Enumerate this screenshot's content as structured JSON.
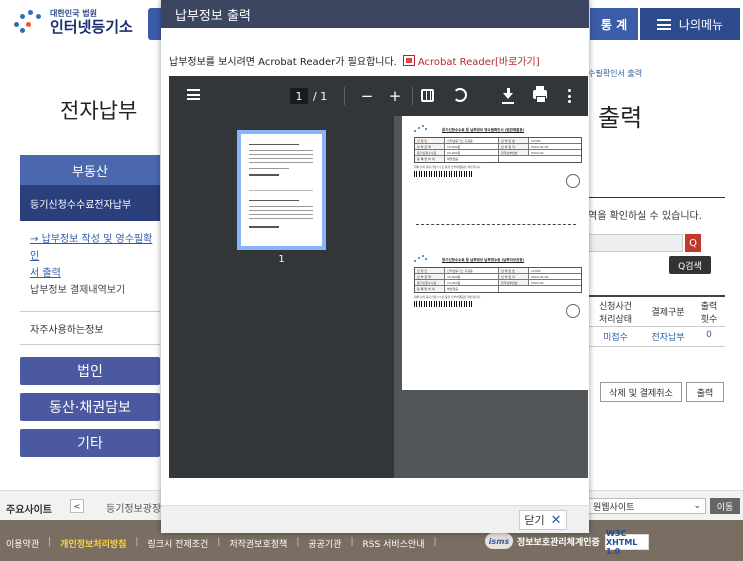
{
  "background": {
    "logo": {
      "top": "대한민국 법원",
      "main": "인터넷등기소"
    },
    "nav": {
      "stat": "통 계",
      "menu": "나의메뉴"
    },
    "breadcrumb": "수필확인서 출력",
    "title_left": "전자납부",
    "title_right": "출력",
    "sidebar": {
      "header": "부동산",
      "sub": "등기신청수수료전자납부",
      "links": [
        {
          "label": "납부정보 작성 및 영수필확인",
          "style": "link"
        },
        {
          "label": "서 출력",
          "style": "link"
        },
        {
          "label": "납부정보 결제내역보기",
          "style": "plain"
        }
      ],
      "frequent": "자주사용하는정보",
      "buttons": [
        "법인",
        "동산·채권담보",
        "기타"
      ]
    },
    "right_panel": {
      "note": "역을 확인하실 수 있습니다.",
      "search_btn": "Q",
      "find_btn": "Q검색",
      "table": {
        "headers": [
          "신청사건\n처리상태",
          "결제구분",
          "출력\n횟수"
        ],
        "row": [
          "미접수",
          "전자납부",
          "0"
        ]
      },
      "cancel_btn": "삭제 및 결제취소",
      "print_btn": "출력"
    },
    "sites": {
      "label": "주요사이트",
      "prev": "<",
      "item": "등기정보광장",
      "select": "원웹사이트",
      "go": "이동"
    },
    "footer": {
      "links": [
        "이용약관",
        "개인정보처리방침",
        "링크시 전제조건",
        "저작권보호정책",
        "공공기관",
        "RSS 서비스안내"
      ],
      "isms": "정보보호관리체계인증",
      "isms_mark": "isms",
      "w3c": "W3C XHTML 1.0"
    }
  },
  "modal": {
    "title": "납부정보 출력",
    "notice": "납부정보를 보시려면 Acrobat Reader가 필요합니다.",
    "acrobat_link": "Acrobat Reader[바로가기]",
    "viewer": {
      "page_current": "1",
      "page_total": "/ 1",
      "zoom_out": "−",
      "zoom_in": "+",
      "thumb_number": "1"
    },
    "close": "닫기"
  },
  "document": {
    "title_top": "등기신청수수료 등 납부정보 영수필확인서 (법원제출용)",
    "title_bottom": "등기신청수수료 등 납부정보 납부영수증 (납부자보관용)",
    "rows": [
      [
        "신 청 인",
        "인터넷등기소 홍길동",
        "납 부 번 호",
        "12345"
      ],
      [
        "납 부 금 액",
        "15,000원",
        "납 부 일 자",
        "2024-01-02"
      ],
      [
        "등기신청수수료",
        "15,000원",
        "전자납부번호",
        "0000-00"
      ],
      [
        "등 록 면 허 세",
        "해당없음",
        "",
        ""
      ]
    ],
    "note": "위와 같이 등기신청수수료 등을 납부하였음을 확인합니다."
  },
  "colors": {
    "modal_title_bg": "#3c4660",
    "viewer_toolbar": "#323639",
    "viewer_bg": "#525659",
    "thumb_highlight": "#8ab4f8",
    "acrobat_link": "#b3282d",
    "footer_bg": "#7a6e62"
  }
}
